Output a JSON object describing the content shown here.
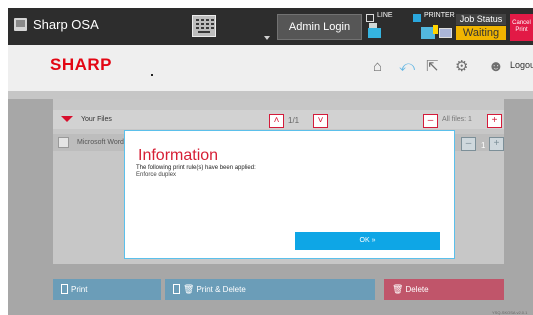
{
  "topbar": {
    "app_name": "Sharp OSA",
    "admin_login": "Admin Login",
    "line_label": "LINE",
    "printer_label": "PRINTER",
    "job_status_label": "Job Status",
    "job_status_value": "Waiting",
    "cancel_print": "Cancel Print"
  },
  "header": {
    "logo": "SHARP",
    "logout_label": "Logout",
    "icons": [
      "home-icon",
      "back-icon",
      "resize-icon",
      "settings-icon",
      "logout-user-icon"
    ]
  },
  "files": {
    "title": "Your Files",
    "page_indicator": "1/1",
    "all_files_label": "All files: 1",
    "row_label": "Microsoft Word",
    "copies": "1"
  },
  "actions": {
    "print": "Print",
    "print_delete": "Print & Delete",
    "delete": "Delete"
  },
  "version": "YSQ-SKOSA v2.0.1",
  "dialog": {
    "title": "Information",
    "message": "The following print rule(s) have been applied:",
    "rule": "Enforce duplex",
    "ok_label": "OK »"
  },
  "colors": {
    "accent_red": "#d41b3a",
    "accent_blue": "#0ea6e6",
    "status_yellow": "#f0b400"
  }
}
